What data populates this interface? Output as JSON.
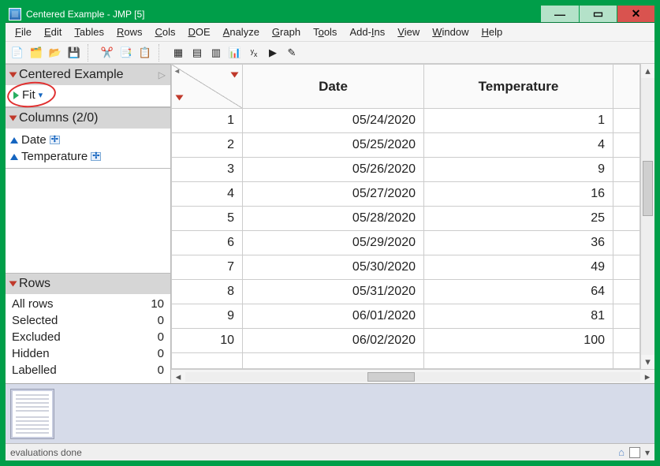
{
  "window": {
    "title": "Centered Example - JMP [5]"
  },
  "menu": {
    "file": "File",
    "edit": "Edit",
    "tables": "Tables",
    "rows": "Rows",
    "cols": "Cols",
    "doe": "DOE",
    "analyze": "Analyze",
    "graph": "Graph",
    "tools": "Tools",
    "addins": "Add-Ins",
    "view": "View",
    "window": "Window",
    "help": "Help"
  },
  "left": {
    "tableName": "Centered Example",
    "scriptName": "Fit",
    "columnsHeader": "Columns (2/0)",
    "columns": [
      {
        "name": "Date"
      },
      {
        "name": "Temperature"
      }
    ],
    "rowsHeader": "Rows",
    "rows": {
      "allLabel": "All rows",
      "allValue": "10",
      "selLabel": "Selected",
      "selValue": "0",
      "excLabel": "Excluded",
      "excValue": "0",
      "hidLabel": "Hidden",
      "hidValue": "0",
      "labLabel": "Labelled",
      "labValue": "0"
    }
  },
  "grid": {
    "headers": {
      "c1": "Date",
      "c2": "Temperature"
    },
    "rows": [
      {
        "n": "1",
        "date": "05/24/2020",
        "temp": "1"
      },
      {
        "n": "2",
        "date": "05/25/2020",
        "temp": "4"
      },
      {
        "n": "3",
        "date": "05/26/2020",
        "temp": "9"
      },
      {
        "n": "4",
        "date": "05/27/2020",
        "temp": "16"
      },
      {
        "n": "5",
        "date": "05/28/2020",
        "temp": "25"
      },
      {
        "n": "6",
        "date": "05/29/2020",
        "temp": "36"
      },
      {
        "n": "7",
        "date": "05/30/2020",
        "temp": "49"
      },
      {
        "n": "8",
        "date": "05/31/2020",
        "temp": "64"
      },
      {
        "n": "9",
        "date": "06/01/2020",
        "temp": "81"
      },
      {
        "n": "10",
        "date": "06/02/2020",
        "temp": "100"
      }
    ]
  },
  "status": {
    "text": "evaluations done"
  }
}
